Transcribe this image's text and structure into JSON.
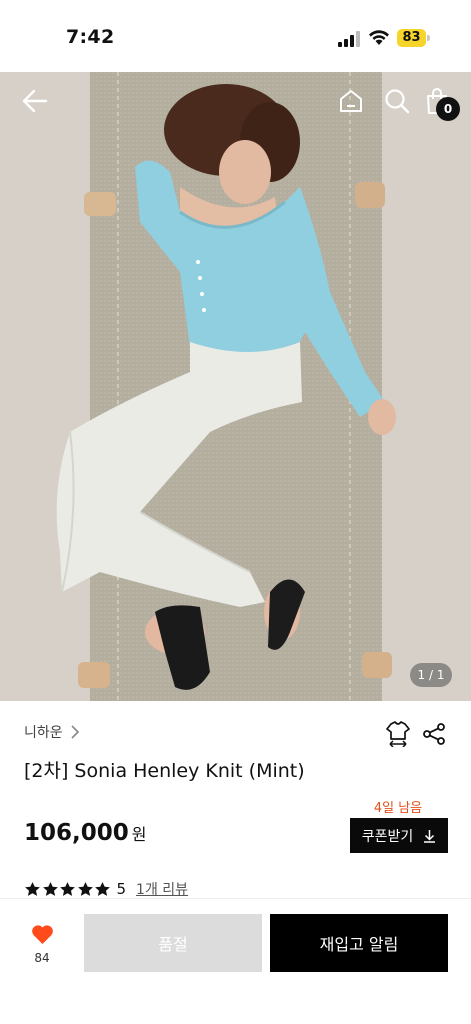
{
  "status_bar": {
    "time": "7:42",
    "battery": "83"
  },
  "top_nav": {
    "cart_count": "0"
  },
  "hero": {
    "pager": "1 / 1"
  },
  "product": {
    "brand": "니하운",
    "title": "[2차] Sonia Henley Knit (Mint)",
    "days_left": "4일 남음",
    "price": "106,000",
    "currency": "원",
    "coupon_label": "쿠폰받기",
    "rating": "5",
    "review_link": "1개 리뷰",
    "stars": 5
  },
  "bottom_bar": {
    "like_count": "84",
    "soldout_label": "품절",
    "restock_label": "재입고 알림"
  },
  "colors": {
    "accent_orange": "#e0531e",
    "like_red": "#ff4a1c",
    "battery_yellow": "#f7d42a",
    "knit_mint": "#8fcfdf"
  },
  "icons": [
    "back-arrow-icon",
    "home-icon",
    "search-icon",
    "shopping-bag-icon",
    "chevron-right-icon",
    "hanger-fit-icon",
    "share-icon",
    "download-icon",
    "star-icon",
    "heart-icon"
  ]
}
